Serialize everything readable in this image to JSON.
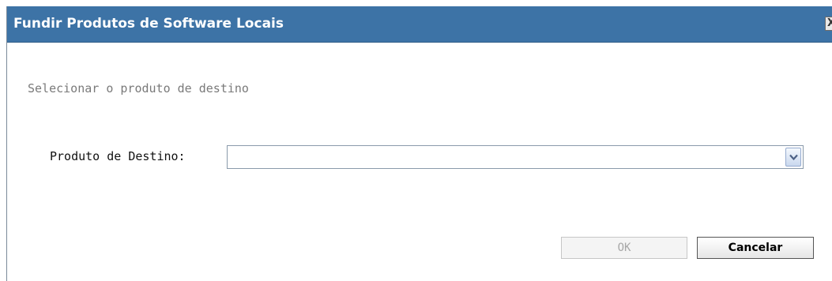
{
  "dialog": {
    "title": "Fundir Produtos de Software Locais",
    "close_glyph": "X",
    "subtitle": "Selecionar o produto de destino",
    "field": {
      "label": "Produto de Destino:",
      "value": ""
    },
    "buttons": {
      "ok_label": "OK",
      "cancel_label": "Cancelar",
      "ok_enabled": false
    }
  },
  "colors": {
    "titlebar": "#3d73a6",
    "title_text": "#ffffff",
    "subtitle_text": "#7a7a7a",
    "disabled_text": "#a7a7a7"
  },
  "icons": {
    "close": "close-icon",
    "dropdown": "chevron-down-icon"
  }
}
